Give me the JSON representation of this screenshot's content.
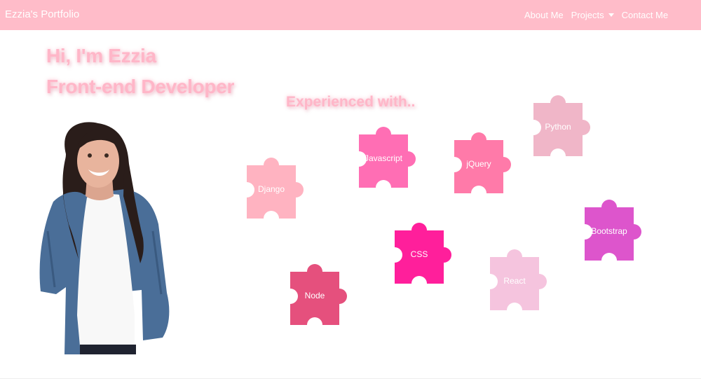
{
  "navbar": {
    "brand": "Ezzia's Portfolio",
    "links": [
      {
        "label": "About Me"
      },
      {
        "label": "Projects"
      },
      {
        "label": "Contact Me"
      }
    ],
    "background": "#ffbcc9"
  },
  "hero": {
    "greeting": "Hi, I'm Ezzia",
    "role": "Front-end Developer",
    "experienced_heading": "Experienced with..",
    "text_color": "#ffb6c8"
  },
  "skills": [
    {
      "label": "Javascript",
      "color": "#ff6eb4"
    },
    {
      "label": "jQuery",
      "color": "#ff7aa9"
    },
    {
      "label": "Python",
      "color": "#f0b6c8"
    },
    {
      "label": "Django",
      "color": "#ffb3c1"
    },
    {
      "label": "Bootstrap",
      "color": "#dd55cc"
    },
    {
      "label": "CSS",
      "color": "#ff1f9b"
    },
    {
      "label": "React",
      "color": "#f5c4de"
    },
    {
      "label": "Node",
      "color": "#e5507d"
    }
  ]
}
